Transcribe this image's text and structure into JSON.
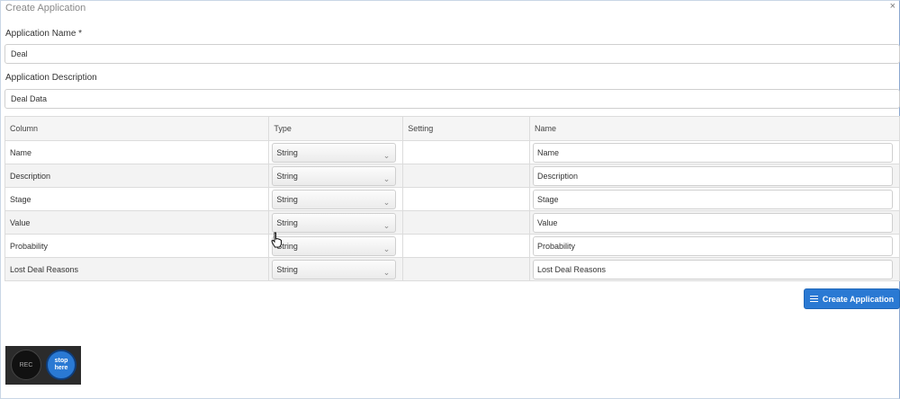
{
  "dialog": {
    "title": "Create Application",
    "close_symbol": "×"
  },
  "form": {
    "name_label": "Application Name *",
    "name_value": "Deal",
    "description_label": "Application Description",
    "description_value": "Deal Data"
  },
  "table": {
    "headers": [
      "Column",
      "Type",
      "Setting",
      "Name"
    ],
    "rows": [
      {
        "column": "Name",
        "type": "String",
        "setting": "",
        "name": "Name"
      },
      {
        "column": "Description",
        "type": "String",
        "setting": "",
        "name": "Description"
      },
      {
        "column": "Stage",
        "type": "String",
        "setting": "",
        "name": "Stage"
      },
      {
        "column": "Value",
        "type": "String",
        "setting": "",
        "name": "Value"
      },
      {
        "column": "Probability",
        "type": "String",
        "setting": "",
        "name": "Probability"
      },
      {
        "column": "Lost Deal Reasons",
        "type": "String",
        "setting": "",
        "name": "Lost Deal Reasons"
      }
    ]
  },
  "actions": {
    "create_label": "Create Application",
    "create_icon": "list-icon"
  },
  "recorder": {
    "rec_label": "REC",
    "stop_label_1": "stop",
    "stop_label_2": "here"
  },
  "colors": {
    "accent": "#2a79d3"
  }
}
